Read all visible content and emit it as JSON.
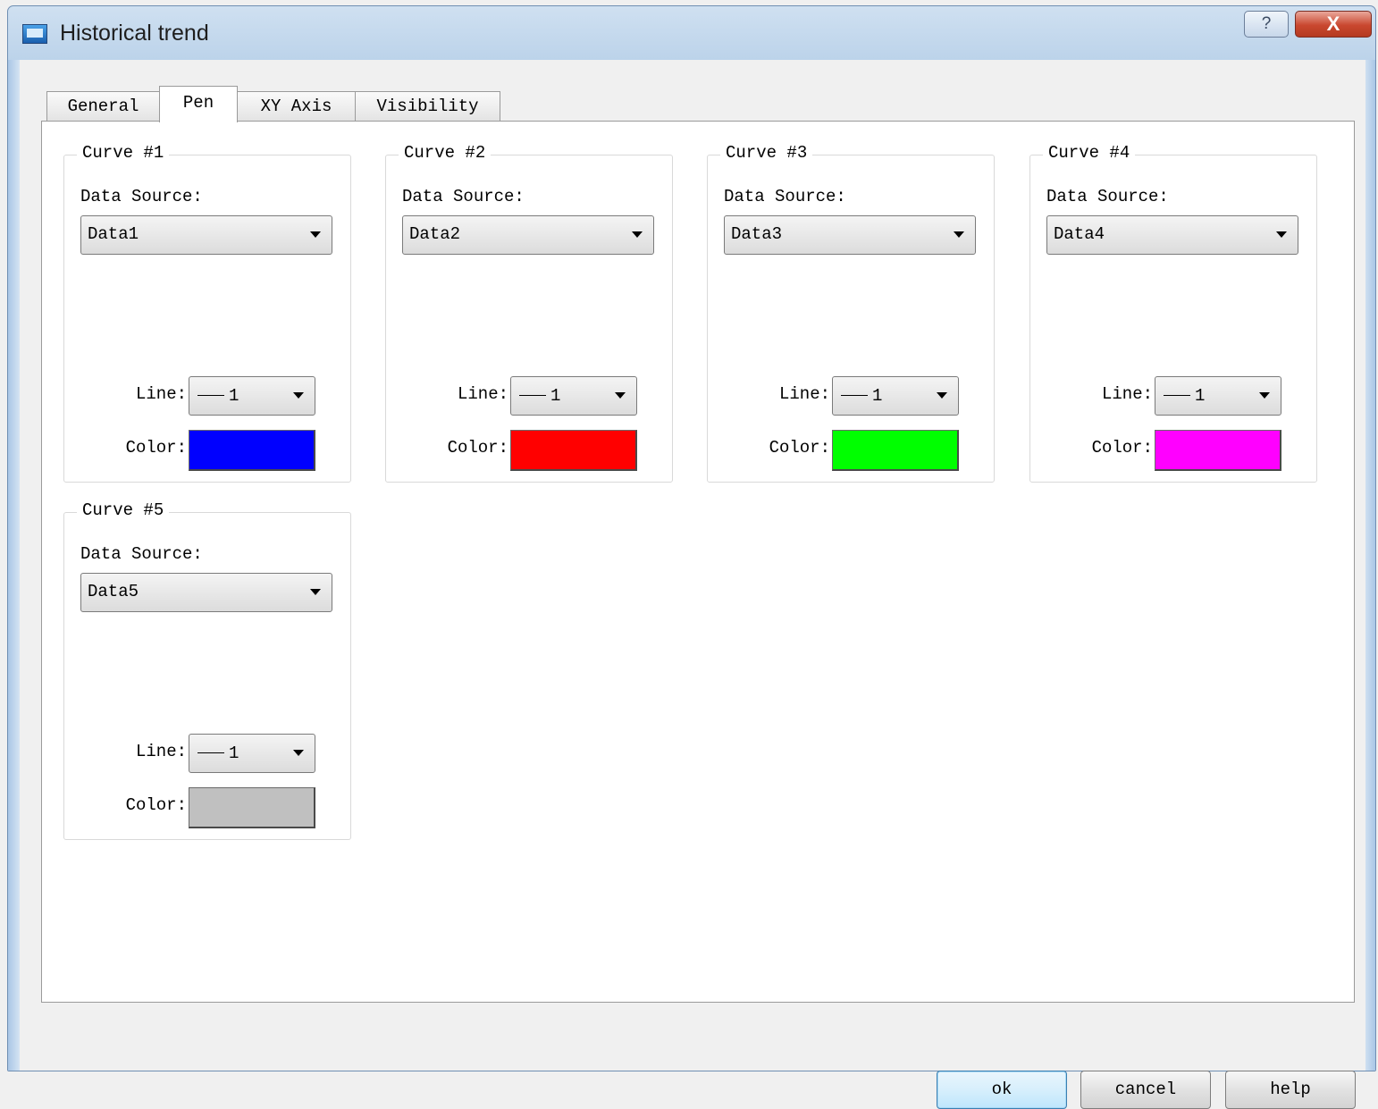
{
  "window": {
    "title": "Historical trend",
    "help_label": "?",
    "close_label": "X"
  },
  "tabs": [
    {
      "label": "General"
    },
    {
      "label": "Pen"
    },
    {
      "label": "XY Axis"
    },
    {
      "label": "Visibility"
    }
  ],
  "active_tab": "Pen",
  "field_labels": {
    "data_source": "Data Source:",
    "line": "Line:",
    "color": "Color:"
  },
  "curves": [
    {
      "title": "Curve #1",
      "data_source": "Data1",
      "line": "1",
      "color": "#0000ff"
    },
    {
      "title": "Curve #2",
      "data_source": "Data2",
      "line": "1",
      "color": "#ff0000"
    },
    {
      "title": "Curve #3",
      "data_source": "Data3",
      "line": "1",
      "color": "#00ff00"
    },
    {
      "title": "Curve #4",
      "data_source": "Data4",
      "line": "1",
      "color": "#ff00ff"
    },
    {
      "title": "Curve #5",
      "data_source": "Data5",
      "line": "1",
      "color": "#c0c0c0"
    }
  ],
  "buttons": {
    "ok": "ok",
    "cancel": "cancel",
    "help": "help"
  }
}
